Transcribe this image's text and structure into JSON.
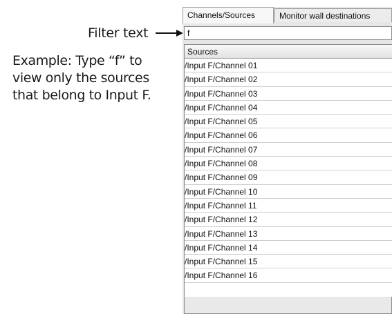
{
  "annotation": {
    "filter_label": "Filter text",
    "example_lines": [
      "Example: Type “f” to",
      "view only the sources",
      "that belong to Input F."
    ]
  },
  "tabs": [
    {
      "label": "Channels/Sources",
      "active": true
    },
    {
      "label": "Monitor wall destinations",
      "active": false
    }
  ],
  "filter": {
    "value": "f"
  },
  "list": {
    "header": "Sources",
    "rows": [
      "/Input F/Channel 01",
      "/Input F/Channel 02",
      "/Input F/Channel 03",
      "/Input F/Channel 04",
      "/Input F/Channel 05",
      "/Input F/Channel 06",
      "/Input F/Channel 07",
      "/Input F/Channel 08",
      "/Input F/Channel 09",
      "/Input F/Channel 10",
      "/Input F/Channel 11",
      "/Input F/Channel 12",
      "/Input F/Channel 13",
      "/Input F/Channel 14",
      "/Input F/Channel 15",
      "/Input F/Channel 16"
    ]
  },
  "colors": {
    "panel_bg": "#e6e6e6",
    "list_bg": "#ffffff",
    "border": "#8a8a8a"
  }
}
